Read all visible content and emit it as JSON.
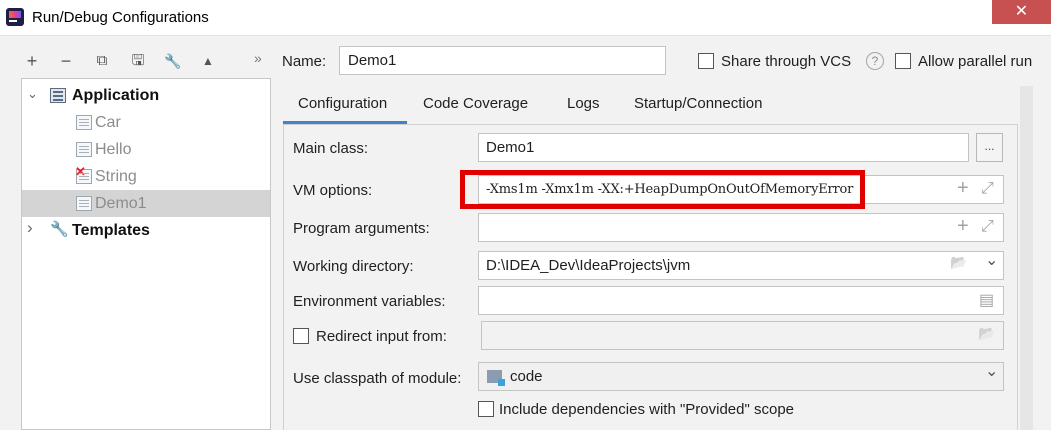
{
  "window": {
    "title": "Run/Debug Configurations",
    "close_glyph": "✕"
  },
  "toolbar": {
    "add": "+",
    "remove": "−",
    "copy": "⧉",
    "save": "🖫",
    "wrench": "🔧",
    "move_up": "▲",
    "more": "»"
  },
  "tree": {
    "application_label": "Application",
    "items": [
      {
        "label": "Car"
      },
      {
        "label": "Hello"
      },
      {
        "label": "String"
      },
      {
        "label": "Demo1"
      }
    ],
    "templates_label": "Templates",
    "error_mark": "✕"
  },
  "name_row": {
    "label": "Name:",
    "value": "Demo1",
    "share_vcs": "Share through VCS",
    "help": "?",
    "allow_parallel": "Allow parallel run"
  },
  "tabs": [
    "Configuration",
    "Code Coverage",
    "Logs",
    "Startup/Connection"
  ],
  "fields": {
    "main_class_label": "Main class:",
    "main_class_value": "Demo1",
    "browse": "...",
    "vm_options_label": "VM options:",
    "vm_options_value": "-Xms1m -Xmx1m -XX:+HeapDumpOnOutOfMemoryError",
    "program_args_label": "Program arguments:",
    "working_dir_label": "Working directory:",
    "working_dir_value": "D:\\IDEA_Dev\\IdeaProjects\\jvm",
    "env_vars_label": "Environment variables:",
    "redirect_label": "Redirect input from:",
    "classpath_label": "Use classpath of module:",
    "classpath_value": "code",
    "include_deps_label": "Include dependencies with \"Provided\" scope"
  },
  "glyphs": {
    "plus": "+",
    "expand": "⤢",
    "folder": "📂",
    "dropdown": "⌄",
    "doc": "▤",
    "chevron_down": "⌄",
    "chevron_right": "›"
  }
}
